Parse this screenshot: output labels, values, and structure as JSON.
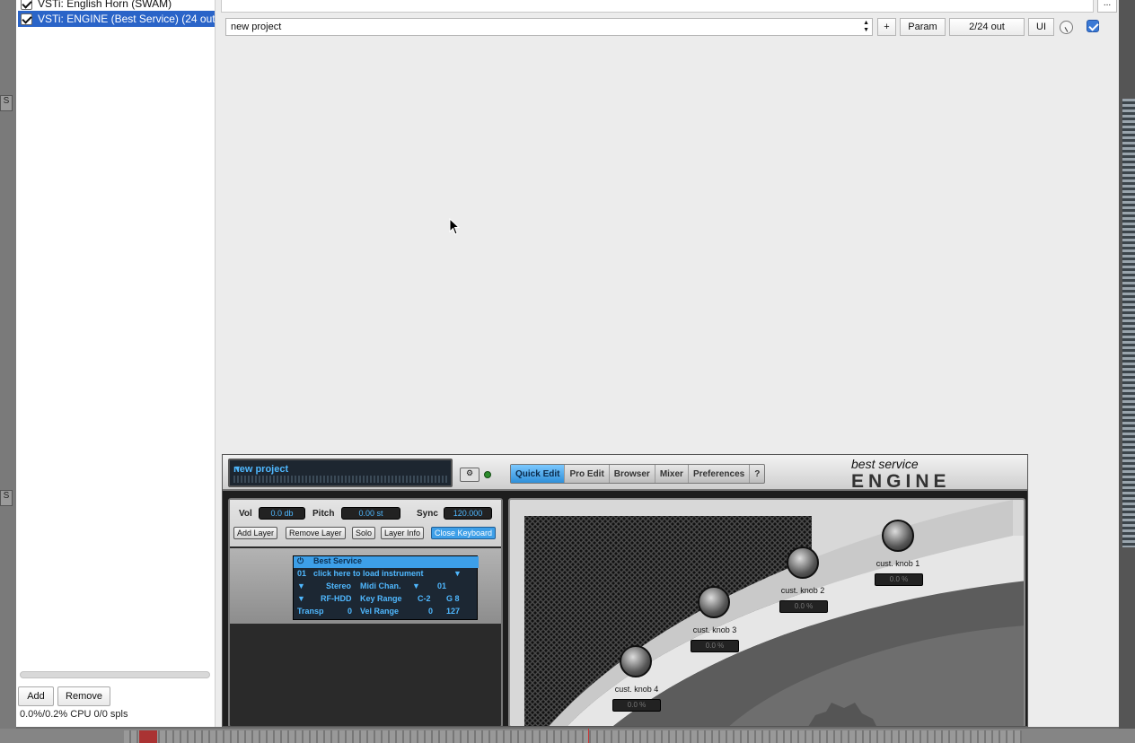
{
  "fx_list": {
    "items": [
      {
        "label": "VSTi: English Horn (SWAM)",
        "checked": true,
        "selected": false
      },
      {
        "label": "VSTi: ENGINE (Best Service) (24 out)",
        "checked": true,
        "selected": true
      }
    ],
    "add_label": "Add",
    "remove_label": "Remove",
    "cpu_text": "0.0%/0.2% CPU 0/0 spls"
  },
  "header": {
    "more_label": "...",
    "preset_value": "new project",
    "plus_label": "+",
    "param_label": "Param",
    "io_label": "2/24 out",
    "ui_label": "UI",
    "bypass_checked": true
  },
  "engine": {
    "preset_name": "new project",
    "tabs": [
      "Quick Edit",
      "Pro Edit",
      "Browser",
      "Mixer",
      "Preferences",
      "?"
    ],
    "active_tab": "Quick Edit",
    "logo_top": "best service",
    "logo_bottom": "ENGINE",
    "vol_label": "Vol",
    "vol_value": "0.0 db",
    "pitch_label": "Pitch",
    "pitch_value": "0.00 st",
    "sync_label": "Sync",
    "sync_value": "120.000",
    "buttons": [
      "Add Layer",
      "Remove Layer",
      "Solo",
      "Layer Info",
      "Close Keyboard"
    ],
    "layer": {
      "name": "Best Service",
      "slot_number": "01",
      "load_text": "click here to load instrument",
      "output": "Stereo",
      "midi_label": "Midi Chan.",
      "midi_value": "01",
      "route": "RF-HDD",
      "key_label": "Key Range",
      "key_low": "C-2",
      "key_high": "G 8",
      "transp_label": "Transp",
      "transp_value": "0",
      "vel_label": "Vel Range",
      "vel_low": "0",
      "vel_high": "127"
    },
    "knobs": [
      {
        "label": "cust. knob 1",
        "value": "0.0 %"
      },
      {
        "label": "cust. knob 2",
        "value": "0.0 %"
      },
      {
        "label": "cust. knob 3",
        "value": "0.0 %"
      },
      {
        "label": "cust. knob 4",
        "value": "0.0 %"
      }
    ]
  },
  "colors": {
    "selection": "#2a64c8",
    "accent": "#3d9fe8",
    "lcd_text": "#4fb8ff"
  }
}
